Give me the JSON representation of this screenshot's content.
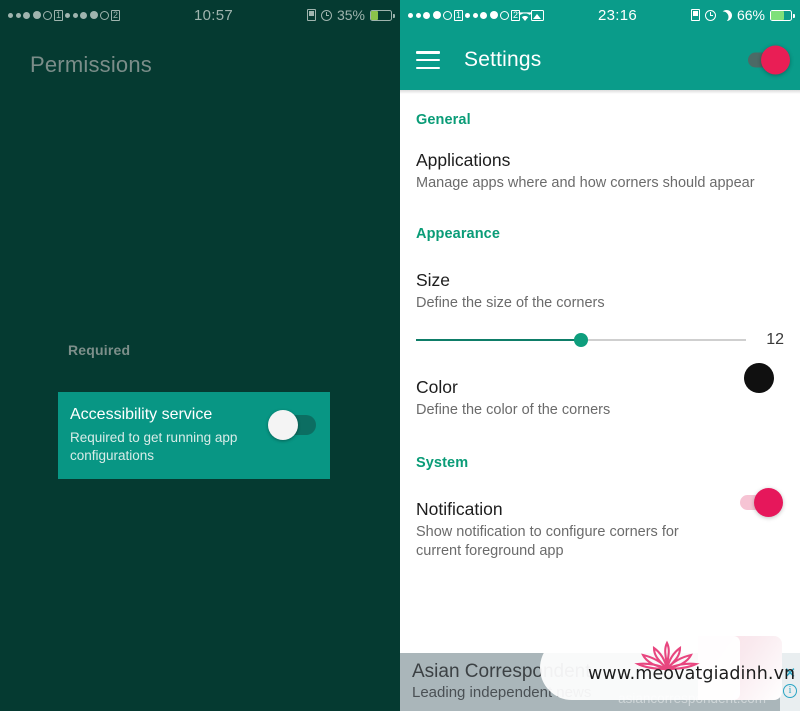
{
  "left_screen": {
    "status_bar": {
      "time": "10:57",
      "battery_percent": "35%",
      "icons": [
        "signal-dots-sim1",
        "signal-dots-sim2",
        "sim-card-icon",
        "alarm-icon",
        "battery-icon"
      ]
    },
    "page_title": "Permissions",
    "required_label": "Required",
    "permission_card": {
      "title": "Accessibility service",
      "subtitle": "Required to get running app configurations",
      "toggle_state": "off",
      "card_color": "#089684"
    },
    "background_color": "#053a31"
  },
  "right_screen": {
    "status_bar": {
      "time": "23:16",
      "battery_percent": "66%",
      "icons": [
        "signal-dots-sim1",
        "signal-dots-sim2",
        "wifi-icon",
        "image-icon",
        "sim-card-icon",
        "alarm-icon",
        "moon-icon",
        "battery-icon"
      ]
    },
    "toolbar": {
      "title": "Settings",
      "menu_icon": "hamburger-menu-icon",
      "master_toggle_state": "on",
      "accent_color": "#0a9c8a",
      "toggle_color": "#e91e55"
    },
    "sections": [
      {
        "header": "General",
        "rows": [
          {
            "title": "Applications",
            "subtitle": "Manage apps where and how corners should appear",
            "control": "none"
          }
        ]
      },
      {
        "header": "Appearance",
        "rows": [
          {
            "title": "Size",
            "subtitle": "Define the size of the corners",
            "control": "slider",
            "slider_value": "12",
            "slider_percent": 50,
            "slider_fill_color": "#0e7d68"
          },
          {
            "title": "Color",
            "subtitle": "Define the color of the corners",
            "control": "color-swatch",
            "swatch_color": "#101010"
          }
        ]
      },
      {
        "header": "System",
        "rows": [
          {
            "title": "Notification",
            "subtitle": "Show notification to configure corners for current foreground app",
            "control": "switch",
            "toggle_state": "on",
            "toggle_color": "#e6175b"
          }
        ]
      }
    ],
    "ad_banner": {
      "title": "Asian Correspondent",
      "subtitle": "Leading independent news",
      "domain": "asiancorrespondent.com",
      "close_label": "✕",
      "info_label": "i"
    }
  },
  "watermark": {
    "url": "www.meovatgiadinh.vn",
    "logo": "lotus-flower-logo",
    "logo_color": "#e8467f"
  }
}
